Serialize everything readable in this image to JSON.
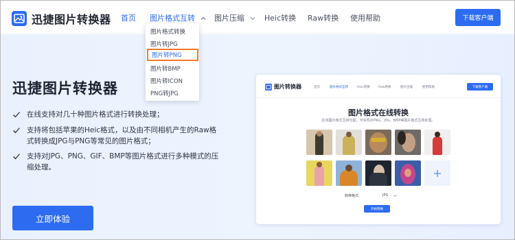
{
  "app": {
    "logo_text": "迅捷图片转换器",
    "accent_color": "#2d6cf0",
    "highlight_color": "#f07a2a"
  },
  "nav": {
    "items": [
      {
        "label": "首页",
        "active": true
      },
      {
        "label": "图片格式互转",
        "has_dropdown": true
      },
      {
        "label": "图片压缩",
        "has_dropdown": true
      },
      {
        "label": "Heic转换"
      },
      {
        "label": "Raw转换"
      },
      {
        "label": "使用帮助"
      }
    ],
    "download_button": "下载客户端"
  },
  "dropdown": {
    "items": [
      {
        "label": "图片格式转换"
      },
      {
        "label": "图片转JPG"
      },
      {
        "label": "图片转PNG",
        "highlighted": true
      },
      {
        "label": "图片转BMP"
      },
      {
        "label": "图片转ICON"
      },
      {
        "label": "PNG转JPG"
      }
    ]
  },
  "hero": {
    "title": "迅捷图片转换器",
    "features": [
      [
        "在线支持对几十种图片格式进行转换处理；"
      ],
      [
        "支持将包括苹果的Heic格式，以及由不同相机产生的Raw格",
        "式转换成JPG与PNG等常见的图片格式；"
      ],
      [
        "支持对JPG、PNG、GIF、BMP等图片格式进行多种模式的压",
        "缩处理。"
      ]
    ],
    "cta_label": "立即体验"
  },
  "preview": {
    "logo_text": "图片转换器",
    "nav": [
      "首页",
      "图片格式互转",
      "Heic转换",
      "Raw转换",
      "图片压缩",
      "使用帮助"
    ],
    "download_button": "下载客户端",
    "title": "图片格式在线转换",
    "subtitle": "在线图片格式互转功能，可实现对PNG、JPG、BMP等图片格式互转处理。",
    "format_label": "转换格式:",
    "format_value": "JPG",
    "start_button": "开始转换",
    "add_icon": "plus-icon"
  }
}
